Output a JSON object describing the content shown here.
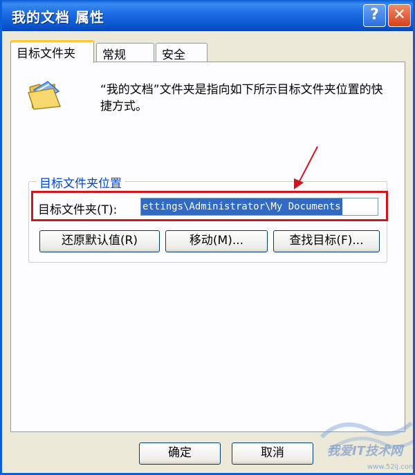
{
  "window": {
    "title": "我的文档 属性",
    "help_glyph": "?",
    "close_glyph": "✕"
  },
  "tabs": [
    {
      "label": "目标文件夹",
      "active": true
    },
    {
      "label": "常规",
      "active": false
    },
    {
      "label": "安全",
      "active": false
    }
  ],
  "description": "“我的文档”文件夹是指向如下所示目标文件夹位置的快捷方式。",
  "group": {
    "title": "目标文件夹位置",
    "target_label": "目标文件夹(T):",
    "target_value": "ettings\\Administrator\\My Documents"
  },
  "buttons": {
    "restore": "还原默认值(R)",
    "move": "移动(M)...",
    "find": "查找目标(F)...",
    "ok": "确定",
    "cancel": "取消"
  },
  "watermark": {
    "text": "我爱IT技术网",
    "sub": "www.52ij.com"
  },
  "colors": {
    "title_bar": "#0a57d0",
    "highlight_box": "#d4141c",
    "selection": "#316ac5",
    "group_title": "#0046d5"
  },
  "icons": [
    "folder-icon",
    "help-icon",
    "close-icon",
    "arrow-icon"
  ]
}
